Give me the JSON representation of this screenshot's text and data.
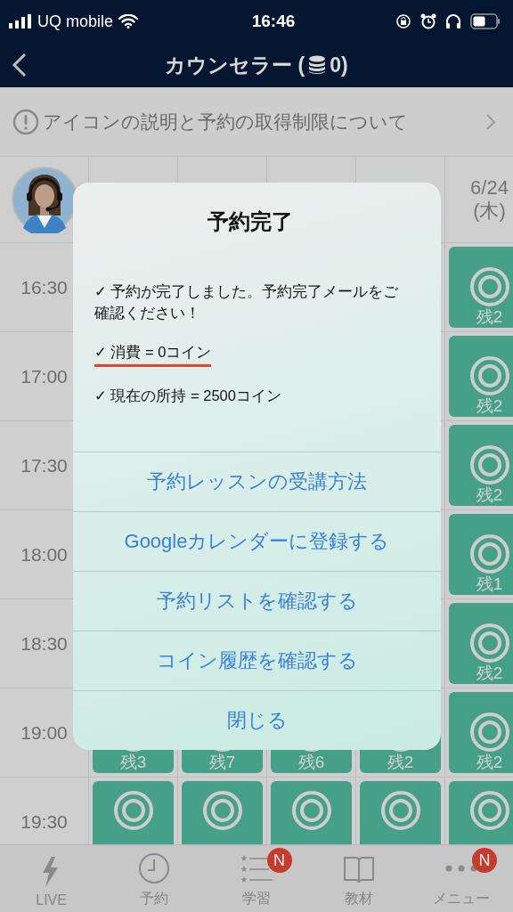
{
  "status_bar": {
    "carrier": "UQ mobile",
    "time": "16:46"
  },
  "header": {
    "title": "カウンセラー (",
    "coin_count": "0)"
  },
  "notice": {
    "text": "アイコンの説明と予約の取得制限について"
  },
  "schedule": {
    "columns": [
      {
        "kind": "covered"
      },
      {
        "kind": "covered"
      },
      {
        "kind": "covered"
      },
      {
        "kind": "covered"
      },
      {
        "kind": "date",
        "date": "6/24",
        "weekday": "(木)"
      }
    ],
    "rows": [
      {
        "time": "16:30",
        "slots": [
          {
            "kind": "covered"
          },
          {
            "kind": "covered"
          },
          {
            "kind": "covered"
          },
          {
            "kind": "covered"
          },
          {
            "kind": "available",
            "remaining": "残2"
          }
        ]
      },
      {
        "time": "17:00",
        "slots": [
          {
            "kind": "covered"
          },
          {
            "kind": "covered"
          },
          {
            "kind": "covered"
          },
          {
            "kind": "covered"
          },
          {
            "kind": "available",
            "remaining": "残2"
          }
        ]
      },
      {
        "time": "17:30",
        "slots": [
          {
            "kind": "covered"
          },
          {
            "kind": "covered"
          },
          {
            "kind": "covered"
          },
          {
            "kind": "covered"
          },
          {
            "kind": "available",
            "remaining": "残2"
          }
        ]
      },
      {
        "time": "18:00",
        "slots": [
          {
            "kind": "covered"
          },
          {
            "kind": "covered"
          },
          {
            "kind": "covered"
          },
          {
            "kind": "covered"
          },
          {
            "kind": "available",
            "remaining": "残1"
          }
        ]
      },
      {
        "time": "18:30",
        "slots": [
          {
            "kind": "covered"
          },
          {
            "kind": "covered"
          },
          {
            "kind": "covered"
          },
          {
            "kind": "covered"
          },
          {
            "kind": "available",
            "remaining": "残2"
          }
        ]
      },
      {
        "time": "19:00",
        "slots": [
          {
            "kind": "available",
            "remaining": "残3"
          },
          {
            "kind": "available",
            "remaining": "残7"
          },
          {
            "kind": "available",
            "remaining": "残6"
          },
          {
            "kind": "available",
            "remaining": "残2"
          },
          {
            "kind": "available",
            "remaining": "残2"
          }
        ]
      },
      {
        "time": "19:30",
        "slots": [
          {
            "kind": "available"
          },
          {
            "kind": "available"
          },
          {
            "kind": "available"
          },
          {
            "kind": "available"
          },
          {
            "kind": "available"
          }
        ]
      }
    ]
  },
  "dialog": {
    "title": "予約完了",
    "lines": [
      {
        "text": "✓ 予約が完了しました。予約完了メールをご確認ください！",
        "highlighted": false
      },
      {
        "text": "✓ 消費 = 0コイン",
        "highlighted": true
      },
      {
        "text": "✓ 現在の所持 = 2500コイン",
        "highlighted": false
      }
    ],
    "actions": [
      "予約レッスンの受講方法",
      "Googleカレンダーに登録する",
      "予約リストを確認する",
      "コイン履歴を確認する",
      "閉じる"
    ]
  },
  "tab_bar": [
    {
      "label": "LIVE"
    },
    {
      "label": "予約"
    },
    {
      "label": "学習",
      "badge": "N"
    },
    {
      "label": "教材"
    },
    {
      "label": "メニュー",
      "badge": "N"
    }
  ]
}
